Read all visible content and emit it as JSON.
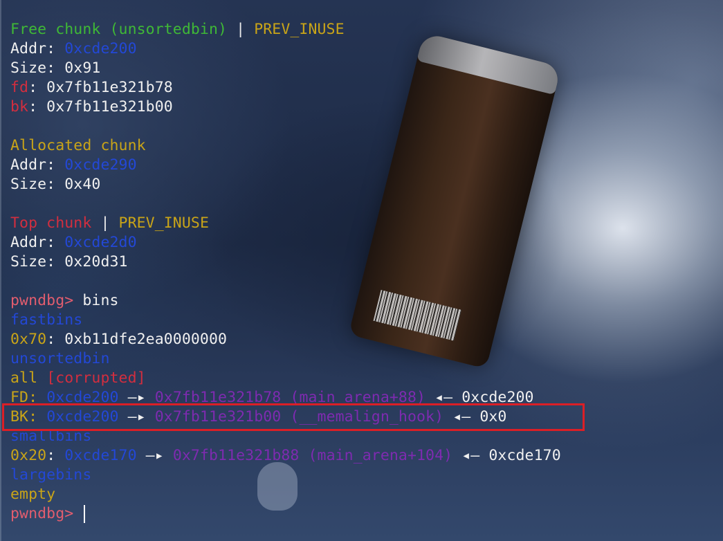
{
  "free_chunk": {
    "title": "Free chunk (unsortedbin)",
    "sep": " | ",
    "flag": "PREV_INUSE",
    "addr_label": "Addr: ",
    "addr": "0xcde200",
    "size_label": "Size: ",
    "size": "0x91",
    "fd_label": "fd",
    "fd_value": ": 0x7fb11e321b78",
    "bk_label": "bk",
    "bk_value": ": 0x7fb11e321b00"
  },
  "allocated_chunk": {
    "title": "Allocated chunk",
    "addr_label": "Addr: ",
    "addr": "0xcde290",
    "size_label": "Size: ",
    "size": "0x40"
  },
  "top_chunk": {
    "title": "Top chunk",
    "sep": " | ",
    "flag": "PREV_INUSE",
    "addr_label": "Addr: ",
    "addr": "0xcde2d0",
    "size_label": "Size: ",
    "size": "0x20d31"
  },
  "prompt": "pwndbg>",
  "command": " bins",
  "fastbins": {
    "header": "fastbins",
    "entry_size": "0x70",
    "entry_value": ": 0xb11dfe2ea0000000"
  },
  "unsortedbin": {
    "header": "unsortedbin",
    "all_label": "all",
    "corrupted": "[corrupted]",
    "fd_label": "FD: ",
    "fd_addr": "0xcde200",
    "fd_arrow": " —▸ ",
    "fd_target": "0x7fb11e321b78 (main_arena+88)",
    "fd_back": " ◂— 0xcde200",
    "bk_label": "BK: ",
    "bk_addr": "0xcde200",
    "bk_arrow": " —▸ ",
    "bk_target": "0x7fb11e321b00 (__memalign_hook)",
    "bk_back": " ◂— 0x0"
  },
  "smallbins": {
    "header": "smallbins",
    "entry_size": "0x20",
    "entry_sep": ": ",
    "entry_addr": "0xcde170",
    "entry_arrow": " —▸ ",
    "entry_target": "0x7fb11e321b88 (main_arena+104)",
    "entry_back": " ◂— 0xcde170"
  },
  "largebins": {
    "header": "largebins",
    "value": "empty"
  },
  "final_prompt": "pwndbg>",
  "colors": {
    "green": "#3fb836",
    "yellow": "#c9a418",
    "blue": "#2348d6",
    "red": "#d22e3f",
    "purple": "#7e2bb0",
    "highlight": "#dc1f26"
  }
}
